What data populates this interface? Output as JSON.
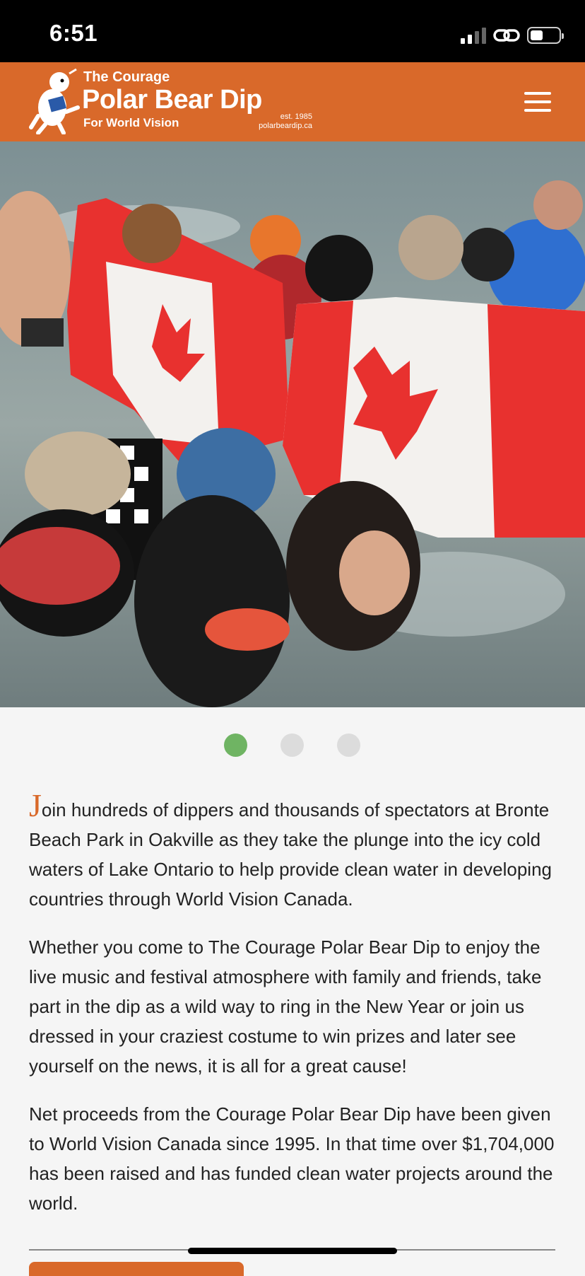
{
  "status_bar": {
    "time": "6:51"
  },
  "header": {
    "logo": {
      "line1": "The Courage",
      "line2": "Polar Bear Dip",
      "line3": "For World Vision",
      "est": "est. 1985",
      "site": "polarbeardip.ca"
    },
    "menu_icon": "hamburger-menu-icon"
  },
  "hero": {
    "image": "people wrapped in Canadian flags running into Lake Ontario",
    "slides": 3,
    "active_slide": 1
  },
  "content": {
    "p1_dropcap": "J",
    "p1_rest": "oin hundreds of dippers and thousands of spectators at Bronte Beach Park in Oakville as they take the plunge into the icy cold waters of Lake Ontario to help provide clean water in developing countries through World Vision Canada.",
    "p2": "Whether you come to The Courage Polar Bear Dip to enjoy the live music and festival atmosphere with family and friends, take part in the dip as a wild way to ring in the New Year or join us dressed in your craziest costume to win prizes and later see yourself on the news, it is all for a great cause!",
    "p3": "Net proceeds from the Courage Polar Bear Dip have been given to World Vision Canada since 1995. In that time over $1,704,000 has been raised and has funded clean water projects around the world."
  },
  "colors": {
    "brand_orange": "#d9692a",
    "active_dot": "#6fb463"
  }
}
